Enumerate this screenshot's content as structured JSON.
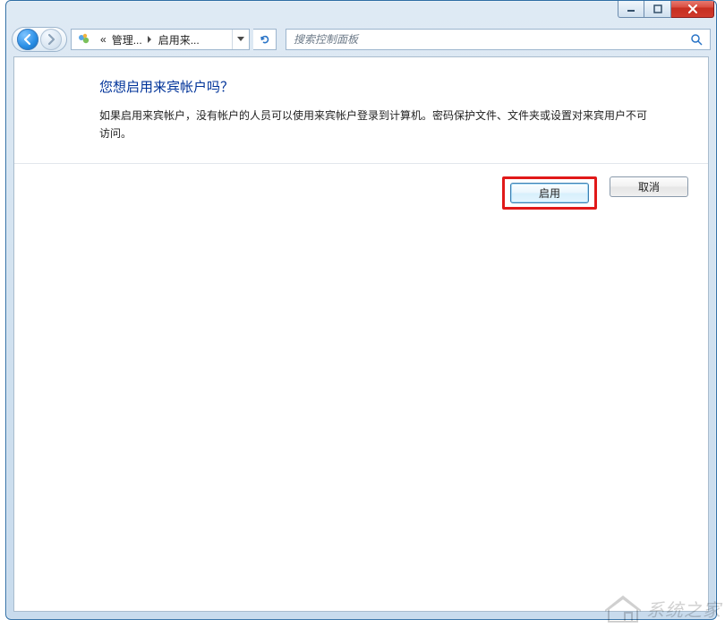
{
  "address": {
    "seg1": "管理...",
    "seg2": "启用来...",
    "prefix": "«"
  },
  "search": {
    "placeholder": "搜索控制面板"
  },
  "page": {
    "title": "您想启用来宾帐户吗？",
    "desc": "如果启用来宾帐户，没有帐户的人员可以使用来宾帐户登录到计算机。密码保护文件、文件夹或设置对来宾用户不可访问。"
  },
  "buttons": {
    "enable": "启用",
    "cancel": "取消"
  },
  "watermark": {
    "text": "系统之家"
  }
}
